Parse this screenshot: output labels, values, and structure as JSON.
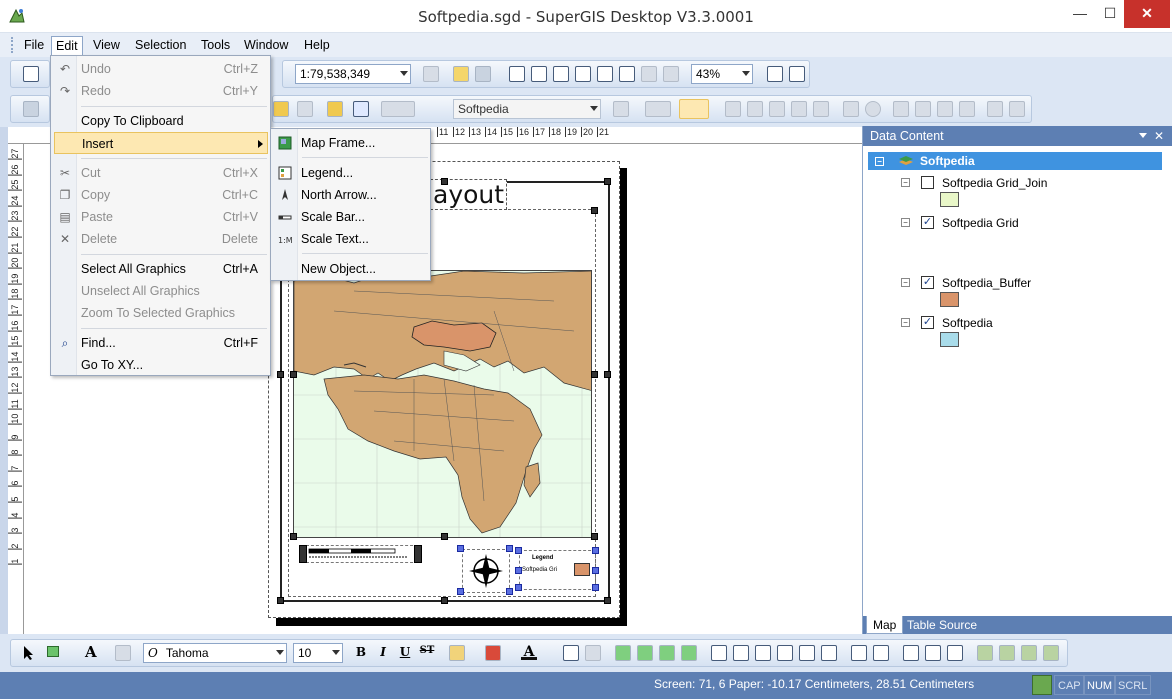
{
  "window": {
    "title": "Softpedia.sgd - SuperGIS Desktop V3.3.0001",
    "min_label": "—",
    "max_label": "☐",
    "close_label": "✕"
  },
  "menubar": {
    "items": [
      "File",
      "Edit",
      "View",
      "Selection",
      "Tools",
      "Window",
      "Help"
    ]
  },
  "toolbar": {
    "scale_value": "1:79,538,349",
    "zoom_value": "43%",
    "layer_value": "Softpedia"
  },
  "edit_menu": {
    "undo": {
      "label": "Undo",
      "shortcut": "Ctrl+Z"
    },
    "redo": {
      "label": "Redo",
      "shortcut": "Ctrl+Y"
    },
    "copy_clipboard": {
      "label": "Copy To Clipboard"
    },
    "insert": {
      "label": "Insert"
    },
    "cut": {
      "label": "Cut",
      "shortcut": "Ctrl+X"
    },
    "copy": {
      "label": "Copy",
      "shortcut": "Ctrl+C"
    },
    "paste": {
      "label": "Paste",
      "shortcut": "Ctrl+V"
    },
    "delete": {
      "label": "Delete",
      "shortcut": "Delete"
    },
    "select_all": {
      "label": "Select All Graphics",
      "shortcut": "Ctrl+A"
    },
    "unselect_all": {
      "label": "Unselect All Graphics"
    },
    "zoom_selected": {
      "label": "Zoom To Selected Graphics"
    },
    "find": {
      "label": "Find...",
      "shortcut": "Ctrl+F"
    },
    "goto_xy": {
      "label": "Go To XY..."
    }
  },
  "insert_menu": {
    "map_frame": "Map Frame...",
    "legend": "Legend...",
    "north_arrow": "North Arrow...",
    "scale_bar": "Scale Bar...",
    "scale_text": "Scale Text...",
    "new_object": "New Object..."
  },
  "layout": {
    "title_text": "ayout",
    "legend_text": "Legend",
    "legend_item": "Softpedia Gri"
  },
  "rulers": {
    "h_ticks": [
      "11",
      "12",
      "13",
      "14",
      "15",
      "16",
      "17",
      "18",
      "19",
      "20",
      "21"
    ],
    "v_ticks": [
      "27",
      "26",
      "25",
      "24",
      "23",
      "22",
      "21",
      "20",
      "19",
      "18",
      "17",
      "16",
      "15",
      "14",
      "13",
      "12",
      "11",
      "10",
      "9",
      "8",
      "7",
      "6",
      "5",
      "4",
      "3",
      "2",
      "1"
    ]
  },
  "data_content": {
    "title": "Data Content",
    "close": "✕",
    "root": "Softpedia",
    "layers": [
      {
        "name": "Softpedia Grid_Join",
        "checked": false,
        "color": "#e9f7c8"
      },
      {
        "name": "Softpedia Grid",
        "checked": true,
        "color": ""
      },
      {
        "name": "Softpedia_Buffer",
        "checked": true,
        "color": "#d9946a"
      },
      {
        "name": "Softpedia",
        "checked": true,
        "color": "#a9dcea"
      }
    ],
    "tabs": [
      "Map",
      "Table Source"
    ]
  },
  "drawbar": {
    "font_name": "Tahoma",
    "font_size": "10",
    "bold": "B",
    "italic": "I",
    "underline": "U",
    "strike": "ST"
  },
  "status": {
    "text": "Screen: 71, 6  Paper: -10.17 Centimeters, 28.51 Centimeters",
    "cap": "CAP",
    "num": "NUM",
    "scrl": "SCRL"
  },
  "colors": {
    "accent": "#5d7fb3",
    "highlight": "#fde8b2",
    "land": "#d2a672",
    "selection_land": "#d9946a",
    "sea": "#eafbea"
  }
}
